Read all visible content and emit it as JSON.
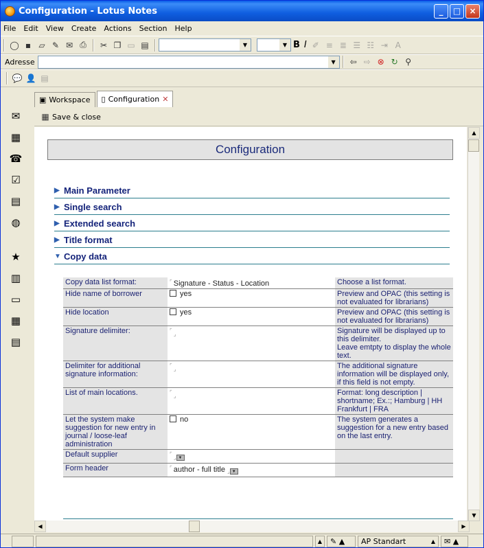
{
  "window": {
    "title": "Configuration - Lotus Notes",
    "min": "_",
    "max": "□",
    "close": "×"
  },
  "menu": [
    "File",
    "Edit",
    "View",
    "Create",
    "Actions",
    "Section",
    "Help"
  ],
  "address": {
    "label": "Adresse",
    "value": ""
  },
  "tabs": [
    {
      "label": "Workspace"
    },
    {
      "label": "Configuration"
    }
  ],
  "actions": {
    "save_close": "Save & close"
  },
  "doc": {
    "title": "Configuration",
    "sections": [
      {
        "label": "Main Parameter",
        "expanded": false
      },
      {
        "label": "Single search",
        "expanded": false
      },
      {
        "label": "Extended search",
        "expanded": false
      },
      {
        "label": "Title format",
        "expanded": false
      },
      {
        "label": "Copy data",
        "expanded": true
      }
    ],
    "rows": [
      {
        "label": "Copy data list format:",
        "value": "Signature - Status - Location",
        "type": "text",
        "help": "Choose a list format."
      },
      {
        "label": "Hide name of borrower",
        "value": "yes",
        "type": "check",
        "help": "Preview and OPAC (this setting is not evaluated for librarians)"
      },
      {
        "label": "Hide location",
        "value": "yes",
        "type": "check",
        "help": "Preview and OPAC (this setting is not evaluated for librarians)"
      },
      {
        "label": "Signature delimiter:",
        "value": "",
        "type": "text",
        "help": "Signature will be displayed up to this delimiter.\nLeave emtpty to display the whole text."
      },
      {
        "label": "Delimiter for additional signature information:",
        "value": "",
        "type": "text",
        "help": "The additional signature information will be displayed only, if this field is not empty."
      },
      {
        "label": "List of main locations.",
        "value": "",
        "type": "text",
        "help": "Format: long description | shortname; Ex.:;  Hamburg | HH  Frankfurt | FRA"
      },
      {
        "label": "Let the system make suggestion for new entry in journal / loose-leaf administration",
        "value": "no",
        "type": "check",
        "help": "The system generates a suggestion for a new entry based on the last entry."
      },
      {
        "label": "Default supplier",
        "value": "",
        "type": "dropdown",
        "help": ""
      },
      {
        "label": "Form header",
        "value": "author - full title",
        "type": "dropdown",
        "help": ""
      }
    ]
  },
  "status": {
    "location": "AP Standart"
  }
}
